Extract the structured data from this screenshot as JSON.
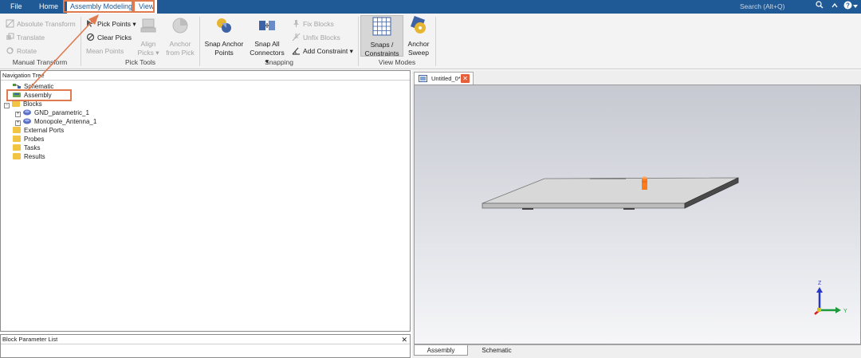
{
  "menubar": {
    "items": [
      "File",
      "Home",
      "Assembly Modeling",
      "View"
    ],
    "active": "Assembly Modeling",
    "search_placeholder": "Search (Alt+Q)"
  },
  "ribbon": {
    "manual_transform": {
      "label": "Manual Transform",
      "items": [
        "Absolute Transform",
        "Translate",
        "Rotate"
      ]
    },
    "pick_tools": {
      "label": "Pick Tools",
      "items": [
        "Pick Points",
        "Clear Picks",
        "Mean Points"
      ],
      "align_picks": [
        "Align",
        "Picks"
      ],
      "anchor_from_pick": [
        "Anchor",
        "from Pick"
      ]
    },
    "snapping": {
      "label": "Snapping",
      "snap_anchor_points": [
        "Snap Anchor",
        "Points"
      ],
      "snap_all_connectors": [
        "Snap All",
        "Connectors"
      ],
      "fix_blocks": "Fix Blocks",
      "unfix_blocks": "Unfix Blocks",
      "add_constraint": "Add Constraint"
    },
    "view_modes": {
      "label": "View Modes",
      "snaps_constraints": [
        "Snaps /",
        "Constraints"
      ],
      "anchor_sweep": [
        "Anchor",
        "Sweep"
      ]
    }
  },
  "nav_tree": {
    "title": "Navigation Tree",
    "items": [
      {
        "label": "Schematic"
      },
      {
        "label": "Assembly"
      },
      {
        "label": "Blocks"
      },
      {
        "label": "GND_parametric_1"
      },
      {
        "label": "Monopole_Antenna_1"
      },
      {
        "label": "External Ports"
      },
      {
        "label": "Probes"
      },
      {
        "label": "Tasks"
      },
      {
        "label": "Results"
      }
    ]
  },
  "param_list": {
    "title": "Block Parameter List"
  },
  "document": {
    "tab_title": "Untitled_0*"
  },
  "bottom_tabs": [
    "Assembly",
    "Schematic"
  ],
  "axes": {
    "z": "Z",
    "y": "Y"
  },
  "colors": {
    "menubar": "#1f5a96",
    "accent_orange": "#e07a4f",
    "antenna": "#ff7a1a"
  }
}
